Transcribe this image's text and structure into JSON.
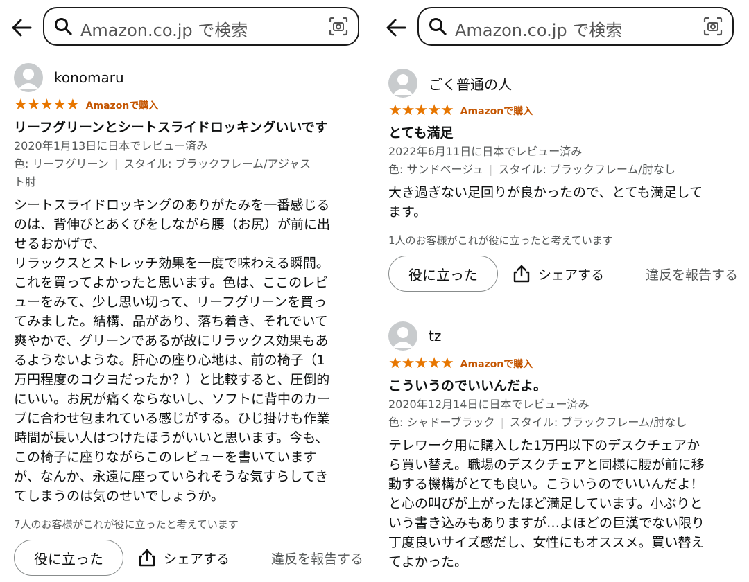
{
  "search": {
    "placeholder": "Amazon.co.jp で検索"
  },
  "reviews": [
    {
      "author": "konomaru",
      "stars": 5,
      "badge": "Amazonで購入",
      "title": "リーフグリーンとシートスライドロッキングいいです",
      "date": "2020年1月13日に日本でレビュー済み",
      "color_label": "色: リーフグリーン",
      "style_label": "スタイル: ブラックフレーム/アジャス",
      "style_label_cont": "ト肘",
      "body": "シートスライドロッキングのありがたみを一番感じる\nのは、背伸びとあくびをしながら腰（お尻）が前に出\nせるおかげで、\nリラックスとストレッチ効果を一度で味わえる瞬間。\nこれを買ってよかったと思います。色は、ここのレビ\nューをみて、少し思い切って、リーフグリーンを買っ\nてみました。結構、品があり、落ち着き、それでいて\n爽やかで、グリーンであるが故にリラックス効果もあ\nるようないような。肝心の座り心地は、前の椅子（1\n万円程度のコクヨだったか？）と比較すると、圧倒的\nにいい。お尻が痛くならないし、ソフトに背中のカー\nブに合わせ包まれている感じがする。ひじ掛けも作業\n時間が長い人はつけたほうがいいと思います。今も、\nこの椅子に座りながらこのレビューを書いています\nが、なんか、永遠に座っていられそうな気すらしてき\nてしまうのは気のせいでしょうか。",
      "helpful": "7人のお客様がこれが役に立ったと考えています",
      "helpful_button": "役に立った",
      "share": "シェアする",
      "report": "違反を報告する"
    },
    {
      "author": "ごく普通の人",
      "stars": 5,
      "badge": "Amazonで購入",
      "title": "とても満足",
      "date": "2022年6月11日に日本でレビュー済み",
      "color_label": "色: サンドベージュ",
      "style_label": "スタイル: ブラックフレーム/肘なし",
      "body": "大き過ぎない足回りが良かったので、とても満足して\nます。",
      "helpful": "1人のお客様がこれが役に立ったと考えています",
      "helpful_button": "役に立った",
      "share": "シェアする",
      "report": "違反を報告する"
    },
    {
      "author": "tz",
      "stars": 5,
      "badge": "Amazonで購入",
      "title": "こういうのでいいんだよ。",
      "date": "2020年12月14日に日本でレビュー済み",
      "color_label": "色: シャドーブラック",
      "style_label": "スタイル: ブラックフレーム/肘なし",
      "body": "テレワーク用に購入した1万円以下のデスクチェアか\nら買い替え。職場のデスクチェアと同様に腰が前に移\n動する機構がとても良い。こういうのでいいんだよ！\nと心の叫びが上がったほど満足しています。小ぶりと\nいう書き込みもありますが…よほどの巨漢でない限り\n丁度良いサイズ感だし、女性にもオススメ。買い替え\nてよかった。"
    }
  ],
  "colors": {
    "star": "#e77600",
    "badge": "#c45500",
    "meta": "#565959"
  }
}
